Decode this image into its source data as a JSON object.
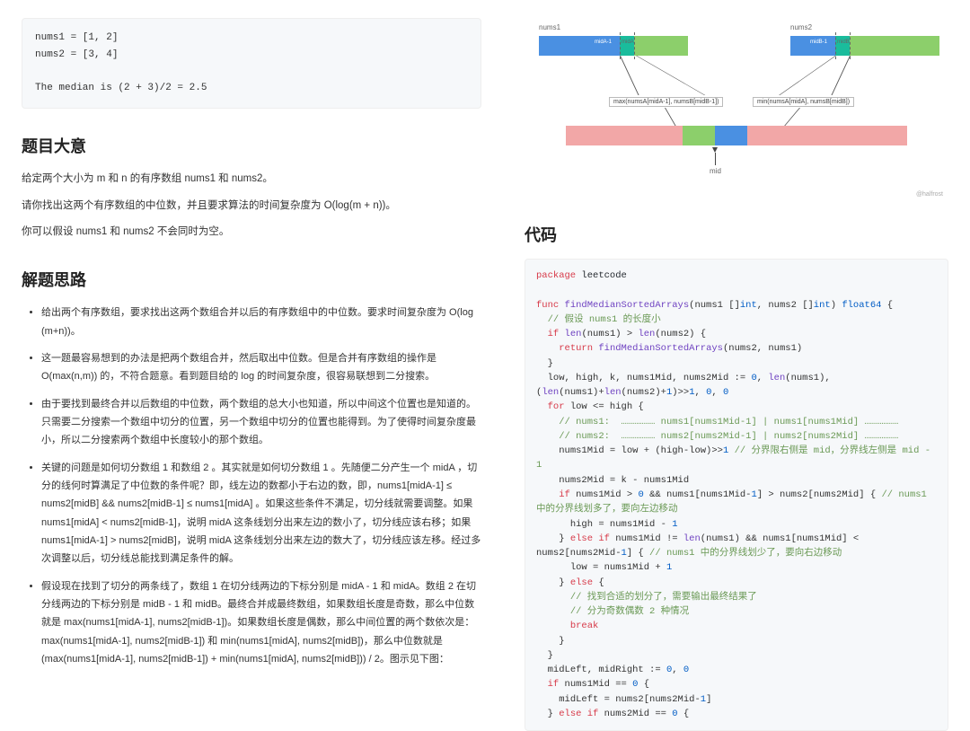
{
  "left": {
    "example_code": "nums1 = [1, 2]\nnums2 = [3, 4]\n\nThe median is (2 + 3)/2 = 2.5",
    "h_summary": "题目大意",
    "p1": "给定两个大小为 m 和 n 的有序数组 nums1 和 nums2。",
    "p2": "请你找出这两个有序数组的中位数，并且要求算法的时间复杂度为 O(log(m + n))。",
    "p3": "你可以假设 nums1 和 nums2 不会同时为空。",
    "h_idea": "解题思路",
    "bullets": [
      "给出两个有序数组，要求找出这两个数组合并以后的有序数组中的中位数。要求时间复杂度为 O(log (m+n))。",
      "这一题最容易想到的办法是把两个数组合并，然后取出中位数。但是合并有序数组的操作是 O(max(n,m)) 的，不符合题意。看到题目给的 log 的时间复杂度，很容易联想到二分搜索。",
      "由于要找到最终合并以后数组的中位数，两个数组的总大小也知道，所以中间这个位置也是知道的。只需要二分搜索一个数组中切分的位置，另一个数组中切分的位置也能得到。为了使得时间复杂度最小，所以二分搜索两个数组中长度较小的那个数组。",
      "关键的问题是如何切分数组 1 和数组 2 。其实就是如何切分数组 1 。先随便二分产生一个 midA ，切分的线何时算满足了中位数的条件呢？即，线左边的数都小于右边的数，即，nums1[midA-1] ≤ nums2[midB] && nums2[midB-1] ≤ nums1[midA] 。如果这些条件不满足，切分线就需要调整。如果 nums1[midA] < nums2[midB-1]，说明 midA 这条线划分出来左边的数小了，切分线应该右移；如果 nums1[midA-1] > nums2[midB]，说明 midA 这条线划分出来左边的数大了，切分线应该左移。经过多次调整以后，切分线总能找到满足条件的解。",
      "假设现在找到了切分的两条线了，数组 1 在切分线两边的下标分别是 midA - 1 和 midA。数组 2 在切分线两边的下标分别是 midB - 1 和 midB。最终合并成最终数组，如果数组长度是奇数，那么中位数就是 max(nums1[midA-1], nums2[midB-1])。如果数组长度是偶数，那么中间位置的两个数依次是：max(nums1[midA-1], nums2[midB-1]) 和 min(nums1[midA], nums2[midB])，那么中位数就是 (max(nums1[midA-1], nums2[midB-1]) + min(nums1[midA], nums2[midB])) / 2。图示见下图："
    ]
  },
  "diagram": {
    "nums1": "nums1",
    "nums2": "nums2",
    "midA1": "midA-1",
    "midA": "midA",
    "midB1": "midB-1",
    "midB": "midB",
    "tag_left": "max(numsA[midA-1], numsB[midB-1])",
    "tag_right": "min(numsA[midA], numsB[midB])",
    "mid": "mid",
    "credit": "@halfrost"
  },
  "right": {
    "h_code": "代码",
    "tokens": [
      {
        "c": "kw",
        "t": "package"
      },
      {
        "t": " "
      },
      {
        "c": "id",
        "t": "leetcode"
      },
      {
        "t": "\n\n"
      },
      {
        "c": "kw",
        "t": "func"
      },
      {
        "t": " "
      },
      {
        "c": "fn",
        "t": "findMedianSortedArrays"
      },
      {
        "t": "(nums1 []"
      },
      {
        "c": "typ",
        "t": "int"
      },
      {
        "t": ", nums2 []"
      },
      {
        "c": "typ",
        "t": "int"
      },
      {
        "t": ") "
      },
      {
        "c": "typ",
        "t": "float64"
      },
      {
        "t": " {\n"
      },
      {
        "t": "  "
      },
      {
        "c": "cm",
        "t": "// 假设 nums1 的长度小"
      },
      {
        "t": "\n"
      },
      {
        "t": "  "
      },
      {
        "c": "kw",
        "t": "if"
      },
      {
        "t": " "
      },
      {
        "c": "fn",
        "t": "len"
      },
      {
        "t": "(nums1) > "
      },
      {
        "c": "fn",
        "t": "len"
      },
      {
        "t": "(nums2) {\n"
      },
      {
        "t": "    "
      },
      {
        "c": "kw",
        "t": "return"
      },
      {
        "t": " "
      },
      {
        "c": "fn",
        "t": "findMedianSortedArrays"
      },
      {
        "t": "(nums2, nums1)\n"
      },
      {
        "t": "  }\n"
      },
      {
        "t": "  low, high, k, nums1Mid, nums2Mid := "
      },
      {
        "c": "num",
        "t": "0"
      },
      {
        "t": ", "
      },
      {
        "c": "fn",
        "t": "len"
      },
      {
        "t": "(nums1), ("
      },
      {
        "c": "fn",
        "t": "len"
      },
      {
        "t": "(nums1)+"
      },
      {
        "c": "fn",
        "t": "len"
      },
      {
        "t": "(nums2)+"
      },
      {
        "c": "num",
        "t": "1"
      },
      {
        "t": ")>>"
      },
      {
        "c": "num",
        "t": "1"
      },
      {
        "t": ", "
      },
      {
        "c": "num",
        "t": "0"
      },
      {
        "t": ", "
      },
      {
        "c": "num",
        "t": "0"
      },
      {
        "t": "\n"
      },
      {
        "t": "  "
      },
      {
        "c": "kw",
        "t": "for"
      },
      {
        "t": " low <= high {\n"
      },
      {
        "t": "    "
      },
      {
        "c": "cm",
        "t": "// nums1:  ……………… nums1[nums1Mid-1] | nums1[nums1Mid] ………………"
      },
      {
        "t": "\n"
      },
      {
        "t": "    "
      },
      {
        "c": "cm",
        "t": "// nums2:  ……………… nums2[nums2Mid-1] | nums2[nums2Mid] ………………"
      },
      {
        "t": "\n"
      },
      {
        "t": "    nums1Mid = low + (high-low)>>"
      },
      {
        "c": "num",
        "t": "1"
      },
      {
        "t": " "
      },
      {
        "c": "cm",
        "t": "// 分界限右侧是 mid，分界线左侧是 mid - 1"
      },
      {
        "t": "\n"
      },
      {
        "t": "    nums2Mid = k - nums1Mid\n"
      },
      {
        "t": "    "
      },
      {
        "c": "kw",
        "t": "if"
      },
      {
        "t": " nums1Mid > "
      },
      {
        "c": "num",
        "t": "0"
      },
      {
        "t": " && nums1[nums1Mid-"
      },
      {
        "c": "num",
        "t": "1"
      },
      {
        "t": "] > nums2[nums2Mid] { "
      },
      {
        "c": "cm",
        "t": "// nums1 中的分界线划多了，要向左边移动"
      },
      {
        "t": "\n"
      },
      {
        "t": "      high = nums1Mid - "
      },
      {
        "c": "num",
        "t": "1"
      },
      {
        "t": "\n"
      },
      {
        "t": "    } "
      },
      {
        "c": "kw",
        "t": "else if"
      },
      {
        "t": " nums1Mid != "
      },
      {
        "c": "fn",
        "t": "len"
      },
      {
        "t": "(nums1) && nums1[nums1Mid] < nums2[nums2Mid-"
      },
      {
        "c": "num",
        "t": "1"
      },
      {
        "t": "] { "
      },
      {
        "c": "cm",
        "t": "// nums1 中的分界线划少了，要向右边移动"
      },
      {
        "t": "\n"
      },
      {
        "t": "      low = nums1Mid + "
      },
      {
        "c": "num",
        "t": "1"
      },
      {
        "t": "\n"
      },
      {
        "t": "    } "
      },
      {
        "c": "kw",
        "t": "else"
      },
      {
        "t": " {\n"
      },
      {
        "t": "      "
      },
      {
        "c": "cm",
        "t": "// 找到合适的划分了，需要输出最终结果了"
      },
      {
        "t": "\n"
      },
      {
        "t": "      "
      },
      {
        "c": "cm",
        "t": "// 分为奇数偶数 2 种情况"
      },
      {
        "t": "\n"
      },
      {
        "t": "      "
      },
      {
        "c": "kw",
        "t": "break"
      },
      {
        "t": "\n"
      },
      {
        "t": "    }\n"
      },
      {
        "t": "  }\n"
      },
      {
        "t": "  midLeft, midRight := "
      },
      {
        "c": "num",
        "t": "0"
      },
      {
        "t": ", "
      },
      {
        "c": "num",
        "t": "0"
      },
      {
        "t": "\n"
      },
      {
        "t": "  "
      },
      {
        "c": "kw",
        "t": "if"
      },
      {
        "t": " nums1Mid == "
      },
      {
        "c": "num",
        "t": "0"
      },
      {
        "t": " {\n"
      },
      {
        "t": "    midLeft = nums2[nums2Mid-"
      },
      {
        "c": "num",
        "t": "1"
      },
      {
        "t": "]\n"
      },
      {
        "t": "  } "
      },
      {
        "c": "kw",
        "t": "else if"
      },
      {
        "t": " nums2Mid == "
      },
      {
        "c": "num",
        "t": "0"
      },
      {
        "t": " {"
      }
    ]
  }
}
